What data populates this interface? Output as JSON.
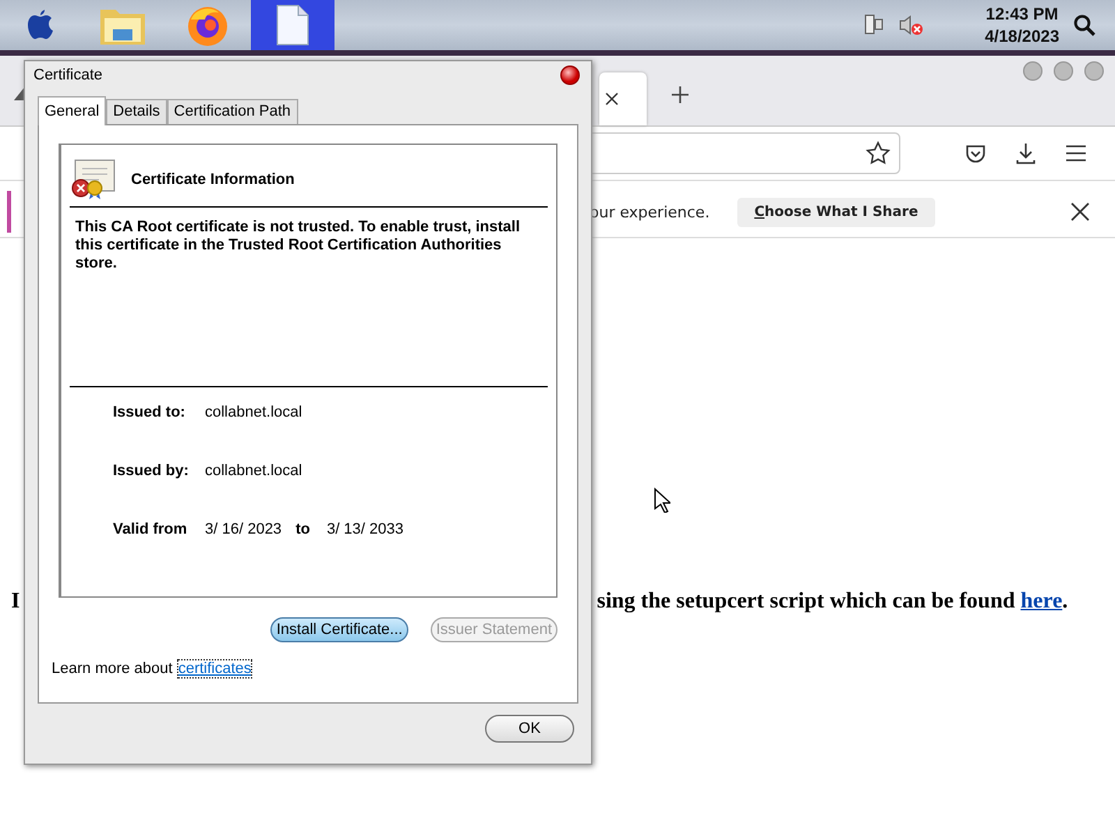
{
  "taskbar": {
    "apps": [
      {
        "kind": "apple",
        "selected": false
      },
      {
        "kind": "folder",
        "selected": false
      },
      {
        "kind": "firefox",
        "selected": false
      },
      {
        "kind": "document",
        "selected": true
      }
    ],
    "clock": {
      "time": "12:43 PM",
      "date": "4/18/2023"
    }
  },
  "browser": {
    "notification": {
      "text": "our experience.",
      "button": "Choose What I Share"
    },
    "page": {
      "line_start": "I",
      "sentence": "sing the setupcert script which can be found ",
      "sentence_link": "here",
      "sentence_end": "."
    }
  },
  "dialog": {
    "title": "Certificate",
    "tabs": [
      {
        "label": "General",
        "selected": true
      },
      {
        "label": "Details",
        "selected": false
      },
      {
        "label": "Certification Path",
        "selected": false
      }
    ],
    "info_title": "Certificate Information",
    "message": "This CA Root certificate is not trusted. To enable trust, install this certificate in the Trusted Root Certification Authorities store.",
    "issued_to": {
      "label": "Issued to:",
      "value": "collabnet.local"
    },
    "issued_by": {
      "label": "Issued by:",
      "value": "collabnet.local"
    },
    "valid": {
      "label": "Valid from",
      "from": "3/ 16/ 2023",
      "to_label": "to",
      "to": "3/ 13/ 2033"
    },
    "buttons": [
      {
        "label": "Install Certificate...",
        "focused": true,
        "disabled": false
      },
      {
        "label": "Issuer Statement",
        "focused": false,
        "disabled": true
      }
    ],
    "learn_more": {
      "text": "Learn more about",
      "link": "certificates"
    },
    "ok": "OK"
  }
}
